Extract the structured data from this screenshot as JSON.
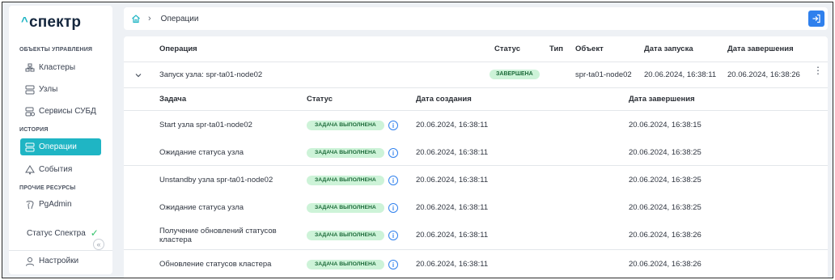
{
  "sidebar": {
    "logo": "спектр",
    "logo_caret": "^",
    "section_management": "ОБЪЕКТЫ УПРАВЛЕНИЯ",
    "item_clusters": "Кластеры",
    "item_nodes": "Узлы",
    "item_dbms": "Сервисы СУБД",
    "section_history": "ИСТОРИЯ",
    "item_operations": "Операции",
    "item_events": "События",
    "section_other": "ПРОЧИЕ РЕСУРСЫ",
    "item_pgadmin": "PgAdmin",
    "status_label": "Статус Спектра",
    "status_check": "✓",
    "collapse_glyph": "«",
    "settings_label": "Настройки"
  },
  "topbar": {
    "breadcrumb_sep": "›",
    "breadcrumb_current": "Операции"
  },
  "table": {
    "columns": {
      "operation": "Операция",
      "status": "Статус",
      "type": "Тип",
      "object": "Объект",
      "start": "Дата запуска",
      "end": "Дата завершения"
    },
    "operation_row": {
      "name": "Запуск узла: spr-ta01-node02",
      "status": "ЗАВЕРШЕНА",
      "type": "",
      "object": "spr-ta01-node02",
      "start": "20.06.2024, 16:38:11",
      "end": "20.06.2024, 16:38:26"
    },
    "task_columns": {
      "task": "Задача",
      "status": "Статус",
      "created": "Дата создания",
      "finished": "Дата завершения"
    },
    "tasks": [
      {
        "name": "Start узла spr-ta01-node02",
        "status": "ЗАДАЧА ВЫПОЛНЕНА",
        "created": "20.06.2024, 16:38:11",
        "finished": "20.06.2024, 16:38:15"
      },
      {
        "name": "Ожидание статуса узла",
        "status": "ЗАДАЧА ВЫПОЛНЕНА",
        "created": "20.06.2024, 16:38:11",
        "finished": "20.06.2024, 16:38:25"
      },
      {
        "name": "Unstandby узла spr-ta01-node02",
        "status": "ЗАДАЧА ВЫПОЛНЕНА",
        "created": "20.06.2024, 16:38:11",
        "finished": "20.06.2024, 16:38:25"
      },
      {
        "name": "Ожидание статуса узла",
        "status": "ЗАДАЧА ВЫПОЛНЕНА",
        "created": "20.06.2024, 16:38:11",
        "finished": "20.06.2024, 16:38:25"
      },
      {
        "name": "Получение обновлений статусов кластера",
        "status": "ЗАДАЧА ВЫПОЛНЕНА",
        "created": "20.06.2024, 16:38:11",
        "finished": "20.06.2024, 16:38:26"
      },
      {
        "name": "Обновление статусов кластера",
        "status": "ЗАДАЧА ВЫПОЛНЕНА",
        "created": "20.06.2024, 16:38:11",
        "finished": "20.06.2024, 16:38:26"
      }
    ],
    "info_glyph": "i",
    "kebab_glyph": "⋮"
  },
  "colors": {
    "accent": "#1fb5c4",
    "primary": "#2f80ed",
    "success_bg": "#cdf3d8",
    "success_text": "#1d6b3a"
  }
}
